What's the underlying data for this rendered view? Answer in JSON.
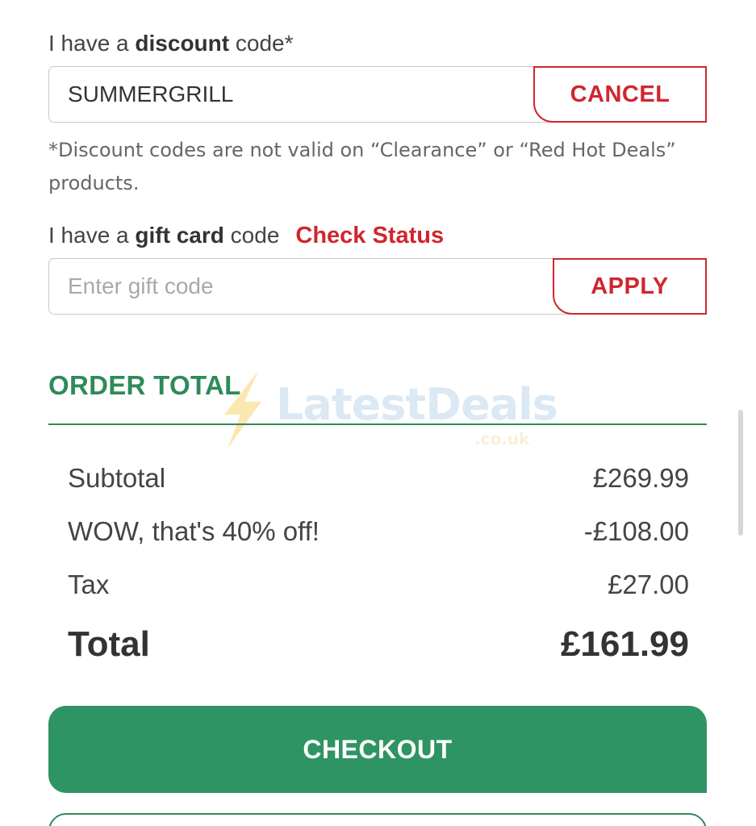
{
  "discount": {
    "label_prefix": "I have a",
    "label_bold": "discount",
    "label_suffix": "code*",
    "value": "SUMMERGRILL",
    "cancel_label": "CANCEL",
    "note": "*Discount codes are not valid on “Clearance” or “Red Hot Deals” products."
  },
  "gift_card": {
    "label_prefix": "I have a",
    "label_bold": "gift card",
    "label_suffix": "code",
    "check_status_label": "Check Status",
    "placeholder": "Enter gift code",
    "apply_label": "APPLY"
  },
  "order_total": {
    "title": "ORDER TOTAL",
    "rows": [
      {
        "label": "Subtotal",
        "value": "£269.99"
      },
      {
        "label": "WOW, that's 40% off!",
        "value": "-£108.00"
      },
      {
        "label": "Tax",
        "value": "£27.00"
      }
    ],
    "total_label": "Total",
    "total_value": "£161.99"
  },
  "checkout": {
    "label": "CHECKOUT"
  },
  "watermark": {
    "brand": "LatestDeals",
    "sub": ".co.uk",
    "icon": "lightning-bolt-icon"
  },
  "colors": {
    "accent_red": "#d0262e",
    "accent_green": "#2e8b57",
    "checkout_green": "#2e9463"
  }
}
